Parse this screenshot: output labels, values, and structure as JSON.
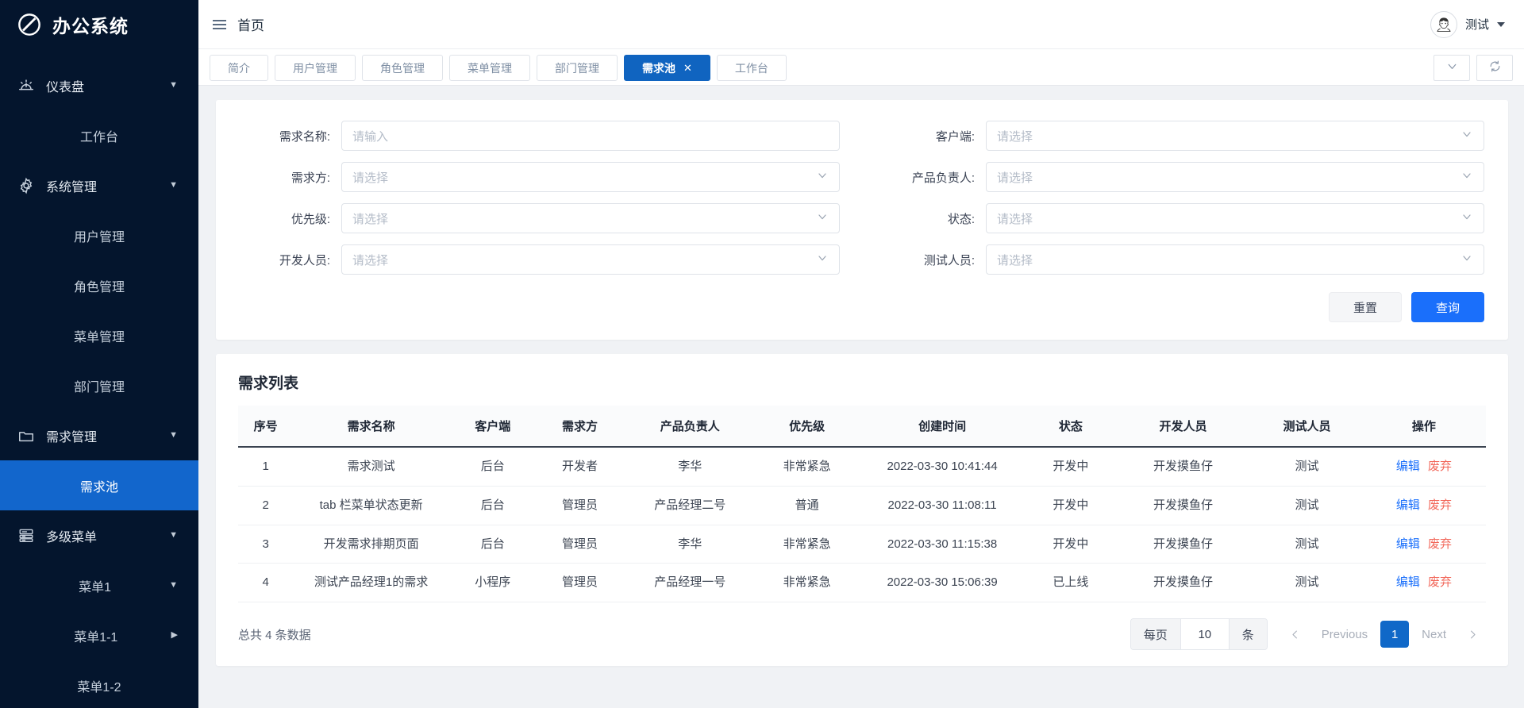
{
  "brand": {
    "name": "办公系统",
    "logo_icon": "slash-circle-logo"
  },
  "topbar": {
    "menu_icon": "hamburger-icon",
    "breadcrumb": "首页",
    "user_name": "测试",
    "avatar_icon": "user-avatar",
    "user_caret_icon": "chevron-down-icon"
  },
  "sidebar": {
    "items": [
      {
        "label": "仪表盘",
        "icon": "dashboard-icon",
        "type": "group",
        "caret": "chevron-down-icon",
        "active": false
      },
      {
        "label": "工作台",
        "icon": "",
        "type": "child",
        "caret": "",
        "active": false
      },
      {
        "label": "系统管理",
        "icon": "gear-icon",
        "type": "group",
        "caret": "chevron-down-icon",
        "active": false
      },
      {
        "label": "用户管理",
        "icon": "",
        "type": "child",
        "caret": "",
        "active": false
      },
      {
        "label": "角色管理",
        "icon": "",
        "type": "child",
        "caret": "",
        "active": false
      },
      {
        "label": "菜单管理",
        "icon": "",
        "type": "child",
        "caret": "",
        "active": false
      },
      {
        "label": "部门管理",
        "icon": "",
        "type": "child",
        "caret": "",
        "active": false
      },
      {
        "label": "需求管理",
        "icon": "folder-icon",
        "type": "group",
        "caret": "chevron-down-icon",
        "active": false
      },
      {
        "label": "需求池",
        "icon": "",
        "type": "child",
        "caret": "",
        "active": true
      },
      {
        "label": "多级菜单",
        "icon": "server-icon",
        "type": "group",
        "caret": "chevron-down-icon",
        "active": false
      },
      {
        "label": "菜单1",
        "icon": "",
        "type": "child",
        "caret": "chevron-down-icon",
        "active": false
      },
      {
        "label": "菜单1-1",
        "icon": "",
        "type": "child",
        "caret": "chevron-right-icon",
        "active": false
      },
      {
        "label": "菜单1-2",
        "icon": "",
        "type": "child",
        "caret": "",
        "active": false
      }
    ]
  },
  "tabbar": {
    "tabs": [
      {
        "label": "简介",
        "active": false,
        "closable": false
      },
      {
        "label": "用户管理",
        "active": false,
        "closable": false
      },
      {
        "label": "角色管理",
        "active": false,
        "closable": false
      },
      {
        "label": "菜单管理",
        "active": false,
        "closable": false
      },
      {
        "label": "部门管理",
        "active": false,
        "closable": false
      },
      {
        "label": "需求池",
        "active": true,
        "closable": true,
        "close_label": "✕"
      },
      {
        "label": "工作台",
        "active": false,
        "closable": false
      }
    ],
    "more_icon": "chevron-down-icon",
    "refresh_icon": "refresh-icon"
  },
  "search": {
    "fields_left": [
      {
        "label": "需求名称:",
        "type": "input",
        "value": "",
        "placeholder": "请输入",
        "name": "demand-name"
      },
      {
        "label": "需求方:",
        "type": "select",
        "value": "请选择",
        "name": "demand-party"
      },
      {
        "label": "优先级:",
        "type": "select",
        "value": "请选择",
        "name": "priority"
      },
      {
        "label": "开发人员:",
        "type": "select",
        "value": "请选择",
        "name": "developer"
      }
    ],
    "fields_right": [
      {
        "label": "客户端:",
        "type": "select",
        "value": "请选择",
        "name": "client"
      },
      {
        "label": "产品负责人:",
        "type": "select",
        "value": "请选择",
        "name": "product-owner"
      },
      {
        "label": "状态:",
        "type": "select",
        "value": "请选择",
        "name": "status"
      },
      {
        "label": "测试人员:",
        "type": "select",
        "value": "请选择",
        "name": "tester"
      }
    ],
    "reset_label": "重置",
    "query_label": "查询"
  },
  "list": {
    "title": "需求列表",
    "columns": [
      "序号",
      "需求名称",
      "客户端",
      "需求方",
      "产品负责人",
      "优先级",
      "创建时间",
      "状态",
      "开发人员",
      "测试人员",
      "操作"
    ],
    "rows": [
      {
        "index": "1",
        "name": "需求测试",
        "client": "后台",
        "party": "开发者",
        "owner": "李华",
        "priority": "非常紧急",
        "created": "2022-03-30 10:41:44",
        "status": "开发中",
        "developer": "开发摸鱼仔",
        "tester": "测试",
        "edit": "编辑",
        "discard": "废弃"
      },
      {
        "index": "2",
        "name": "tab 栏菜单状态更新",
        "client": "后台",
        "party": "管理员",
        "owner": "产品经理二号",
        "priority": "普通",
        "created": "2022-03-30 11:08:11",
        "status": "开发中",
        "developer": "开发摸鱼仔",
        "tester": "测试",
        "edit": "编辑",
        "discard": "废弃"
      },
      {
        "index": "3",
        "name": "开发需求排期页面",
        "client": "后台",
        "party": "管理员",
        "owner": "李华",
        "priority": "非常紧急",
        "created": "2022-03-30 11:15:38",
        "status": "开发中",
        "developer": "开发摸鱼仔",
        "tester": "测试",
        "edit": "编辑",
        "discard": "废弃"
      },
      {
        "index": "4",
        "name": "测试产品经理1的需求",
        "client": "小程序",
        "party": "管理员",
        "owner": "产品经理一号",
        "priority": "非常紧急",
        "created": "2022-03-30 15:06:39",
        "status": "已上线",
        "developer": "开发摸鱼仔",
        "tester": "测试",
        "edit": "编辑",
        "discard": "废弃"
      }
    ],
    "total_text": "总共 4 条数据",
    "pagination": {
      "per_page_label": "每页",
      "per_page_value": "10",
      "per_page_unit": "条",
      "prev_label": "Previous",
      "next_label": "Next",
      "current_page": "1",
      "prev_icon": "chevron-left-icon",
      "next_icon": "chevron-right-icon"
    }
  },
  "colors": {
    "sidebar_bg": "#04152d",
    "sidebar_active": "#1266cc",
    "tab_active": "#1064c0",
    "primary": "#1a6ffb",
    "danger": "#f2675a",
    "page_bg": "#f0f2f5"
  }
}
